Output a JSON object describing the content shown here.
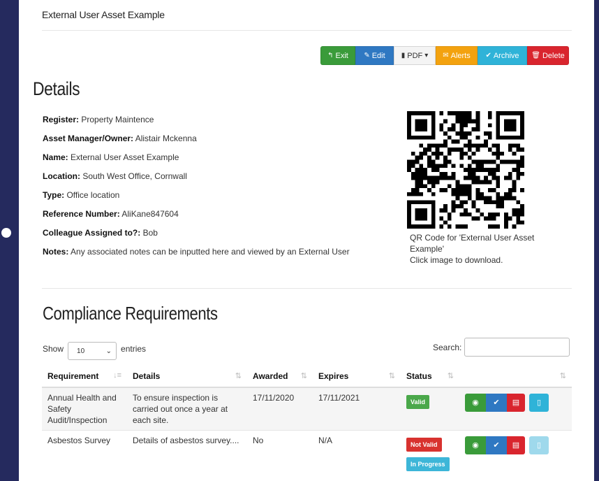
{
  "page": {
    "tab_title": "External User Asset Example"
  },
  "actions": {
    "exit": "Exit",
    "edit": "Edit",
    "pdf": "PDF",
    "alerts": "Alerts",
    "archive": "Archive",
    "delete": "Delete"
  },
  "details": {
    "title": "Details",
    "fields": [
      {
        "label": "Register:",
        "value": "Property Maintence"
      },
      {
        "label": "Asset Manager/Owner:",
        "value": "Alistair Mckenna"
      },
      {
        "label": "Name:",
        "value": "External User Asset Example"
      },
      {
        "label": "Location:",
        "value": "South West Office, Cornwall"
      },
      {
        "label": "Type:",
        "value": "Office location"
      },
      {
        "label": "Reference Number:",
        "value": "AliKane847604"
      },
      {
        "label": "Colleague Assigned to?:",
        "value": "Bob"
      },
      {
        "label": "Notes:",
        "value": "Any associated notes can be inputted here and viewed by an External User"
      }
    ],
    "qr_caption_line1": "QR Code for 'External User Asset Example'",
    "qr_caption_line2": "Click image to download."
  },
  "compliance": {
    "title": "Compliance Requirements",
    "show_label": "Show",
    "entries_value": "10",
    "entries_label": "entries",
    "search_label": "Search:",
    "columns": [
      "Requirement",
      "Details",
      "Awarded",
      "Expires",
      "Status",
      ""
    ],
    "rows": [
      {
        "requirement": "Annual Health and Safety Audit/Inspection",
        "details": "To ensure inspection is carried out once a year at each site.",
        "awarded": "17/11/2020",
        "expires": "17/11/2021",
        "status": [
          "Valid"
        ]
      },
      {
        "requirement": "Asbestos Survey",
        "details": "Details of asbestos survey....",
        "awarded": "No",
        "expires": "N/A",
        "status": [
          "Not Valid",
          "In Progress"
        ]
      }
    ]
  },
  "colors": {
    "background": "#252a5e",
    "green": "#3a9b3a",
    "blue": "#2f78c2",
    "orange": "#f3a20f",
    "cyan": "#2fb3d8",
    "red": "#d9252e"
  },
  "icons": {
    "exit": "reply-arrow-icon",
    "edit": "pencil-square-icon",
    "pdf": "file-icon",
    "alerts": "envelope-icon",
    "archive": "check-circle-icon",
    "delete": "trash-icon"
  }
}
